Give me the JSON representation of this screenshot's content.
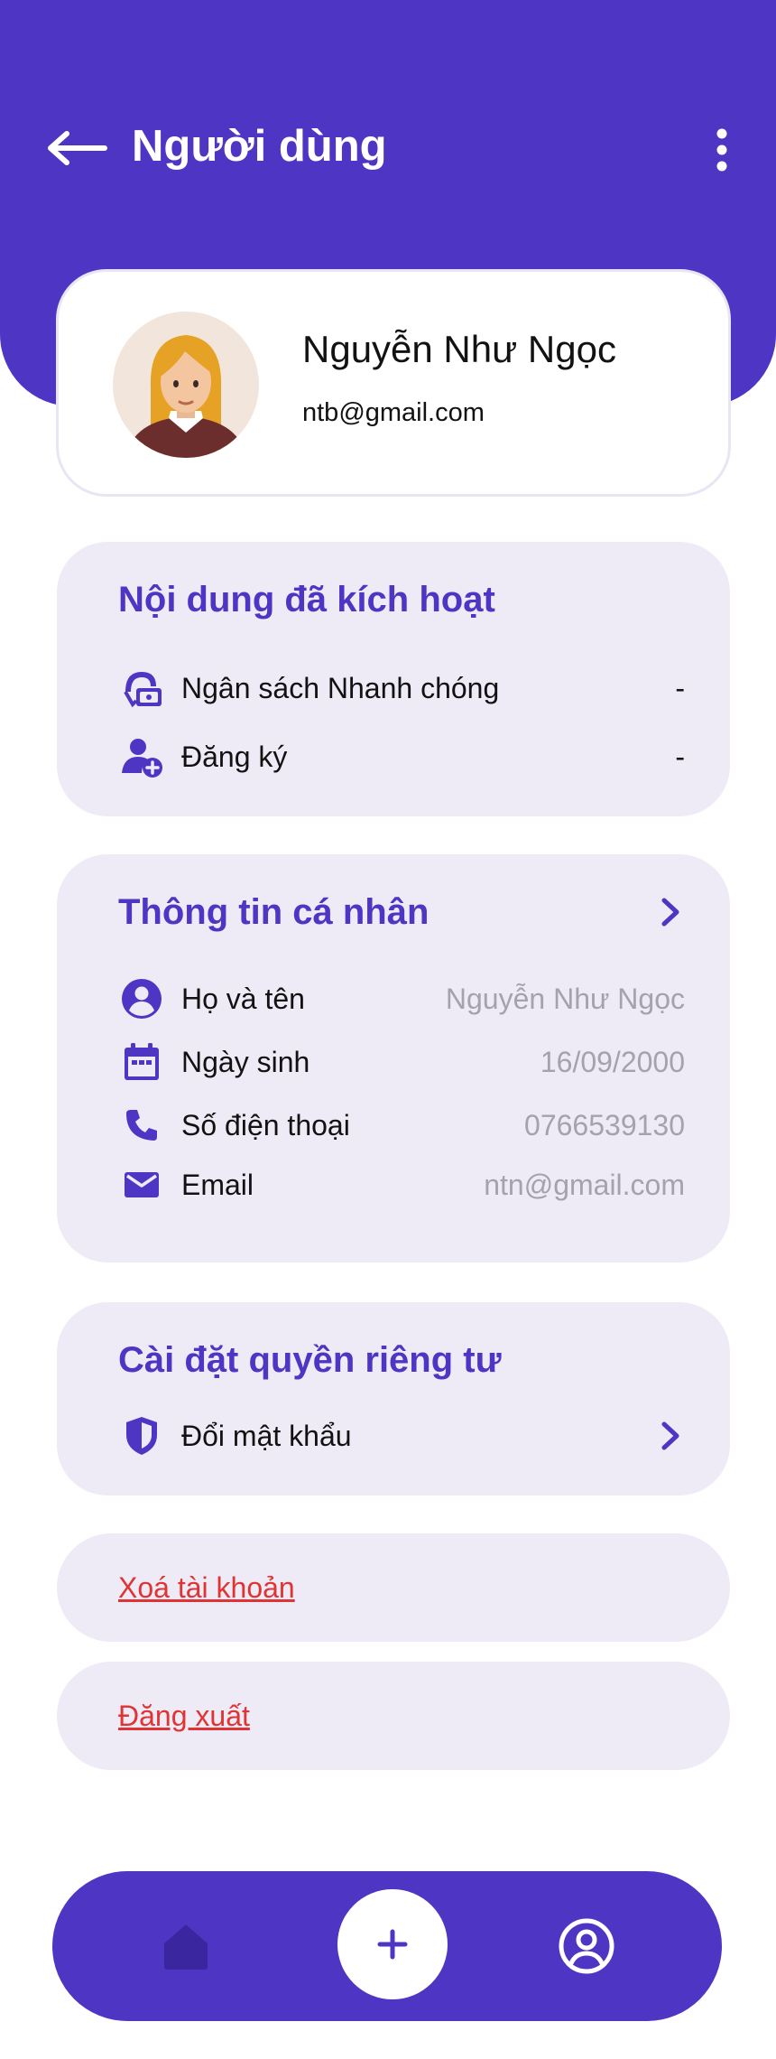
{
  "header": {
    "title": "Người dùng",
    "back_icon": "arrow-left-icon",
    "more_icon": "more-vertical-icon"
  },
  "profile": {
    "name": "Nguyễn Như Ngọc",
    "email": "ntb@gmail.com",
    "avatar_icon": "avatar-woman-illustration"
  },
  "activated": {
    "title": "Nội dung đã kích hoạt",
    "items": [
      {
        "icon": "quick-budget-icon",
        "label": "Ngân sách Nhanh chóng",
        "value": "-"
      },
      {
        "icon": "user-add-icon",
        "label": "Đăng ký",
        "value": "-"
      }
    ]
  },
  "personal": {
    "title": "Thông tin cá nhân",
    "items": [
      {
        "icon": "user-circle-icon",
        "label": "Họ và tên",
        "value": "Nguyễn Như Ngọc"
      },
      {
        "icon": "calendar-icon",
        "label": "Ngày sinh",
        "value": "16/09/2000"
      },
      {
        "icon": "phone-icon",
        "label": "Số điện thoại",
        "value": "0766539130"
      },
      {
        "icon": "mail-icon",
        "label": "Email",
        "value": "ntn@gmail.com"
      }
    ]
  },
  "privacy": {
    "title": "Cài đặt quyền riêng tư",
    "items": [
      {
        "icon": "shield-icon",
        "label": "Đổi mật khẩu"
      }
    ]
  },
  "actions": {
    "delete_account": "Xoá tài khoản",
    "logout": "Đăng xuất"
  },
  "bottom_nav": {
    "items": [
      "home-icon",
      "plus-icon",
      "profile-icon"
    ]
  },
  "colors": {
    "primary": "#4f35c4",
    "card_bg": "#eeebf6",
    "danger": "#e03333",
    "muted_text": "#a4a2ad"
  }
}
